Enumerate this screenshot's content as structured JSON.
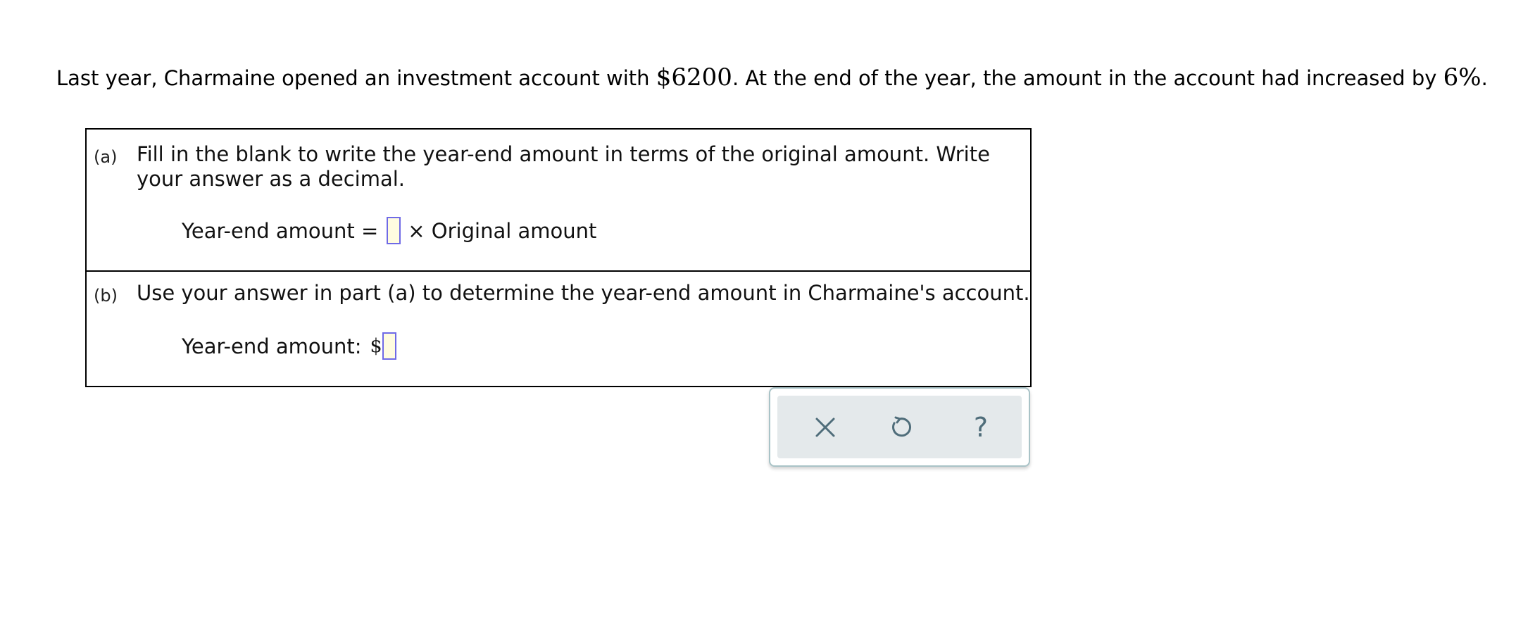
{
  "problem": {
    "intro_before": "Last year, Charmaine opened an investment account with ",
    "amount": "$6200",
    "intro_middle": ". At the end of the year, the amount in the account had increased by ",
    "percent": "6%",
    "intro_end": "."
  },
  "part_a": {
    "label": "(a)",
    "instruction": "Fill in the blank to write the year-end amount in terms of the original amount. Write your answer as a decimal.",
    "lhs": "Year-end amount =",
    "rhs": "× Original amount"
  },
  "part_b": {
    "label": "(b)",
    "instruction": "Use your answer in part (a) to determine the year-end amount in Charmaine's account.",
    "lhs": "Year-end amount:",
    "currency": "$"
  },
  "toolbar": {
    "clear_icon": "close-icon",
    "undo_icon": "undo-icon",
    "help_label": "?"
  },
  "colors": {
    "input_border": "#6f6ae6",
    "input_fill": "#fffce0",
    "toolbar_icon": "#4f6d7a",
    "toolbar_bg": "#e4e9eb"
  }
}
